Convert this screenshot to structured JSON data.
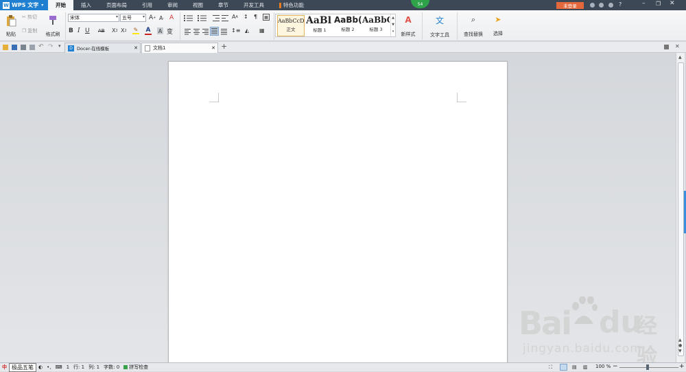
{
  "menubar": {
    "app_name": "WPS 文字",
    "logo_letter": "W",
    "tabs": [
      "开始",
      "插入",
      "页面布局",
      "引用",
      "审阅",
      "视图",
      "章节",
      "开发工具"
    ],
    "special_tab": "特色功能",
    "notify_count": "54",
    "login_label": "未登录",
    "help": "?"
  },
  "ribbon": {
    "paste": "粘贴",
    "cut": "剪切",
    "copy": "复制",
    "format_painter": "格式刷",
    "font_name": "宋体",
    "font_size": "五号",
    "styles": [
      {
        "preview": "AaBbCcDd",
        "label": "正文"
      },
      {
        "preview": "AaBl",
        "label": "标题 1"
      },
      {
        "preview": "AaBb(",
        "label": "标题 2"
      },
      {
        "preview": "AaBbC",
        "label": "标题 3"
      }
    ],
    "new_style": "新样式",
    "text_tools": "文字工具",
    "find_replace": "查找替换",
    "select": "选择",
    "accent": "#1f7fd0"
  },
  "tabs": [
    {
      "label": "Docer-在线模板"
    },
    {
      "label": "文档1"
    }
  ],
  "status": {
    "ime": "极品五笔",
    "row_label": "行: 1",
    "col_label": "列: 1",
    "wordcount_label": "字数: 0",
    "spellcheck": "拼写检查",
    "zoom": "100 %",
    "page_prefix": "1"
  },
  "watermark": {
    "brand": "Bai",
    "brand2": "du",
    "cn": "经验",
    "url": "jingyan.baidu.com"
  }
}
